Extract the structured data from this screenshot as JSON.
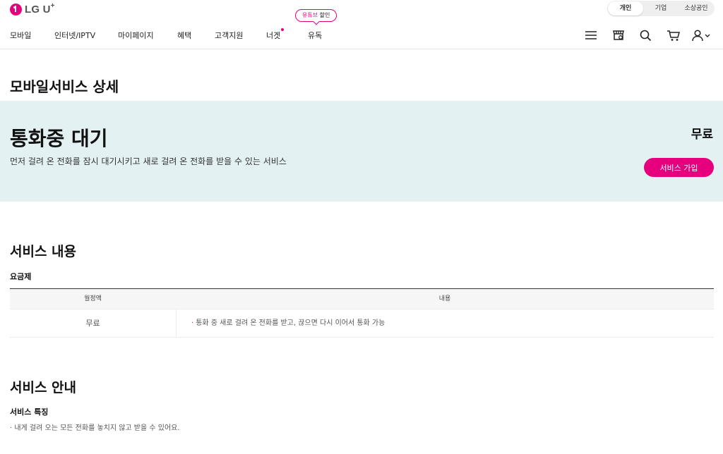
{
  "brand": {
    "logo_text": "LG U",
    "logo_plus": "+"
  },
  "segments": [
    "개인",
    "기업",
    "소상공인"
  ],
  "segment_active": "개인",
  "nav": {
    "items": [
      "모바일",
      "인터넷/IPTV",
      "마이페이지",
      "혜택",
      "고객지원",
      "너겟",
      "유독"
    ],
    "promo_prefix": "유튜브",
    "promo_suffix": "할인",
    "icons": [
      "menu-icon",
      "store-icon",
      "search-icon",
      "cart-icon",
      "user-icon"
    ]
  },
  "page_title": "모바일서비스 상세",
  "hero": {
    "title": "통화중 대기",
    "description": "먼저 걸려 온 전화를 잠시 대기시키고 새로 걸려 온 전화를 받을 수 있는 서비스",
    "price": "무료",
    "join_label": "서비스 가입"
  },
  "service_content": {
    "title": "서비스 내용",
    "subtitle": "요금제",
    "table": {
      "headers": [
        "월정액",
        "내용"
      ],
      "rows": [
        {
          "price": "무료",
          "content": "통화 중 새로 걸려 온 전화를 받고, 끊으면 다시 이어서 통화 가능"
        }
      ]
    }
  },
  "service_guide": {
    "title": "서비스 안내",
    "feature_title": "서비스 특징",
    "feature_text": "· 내게 걸려 오는 모든 전화를 놓치지 않고 받을 수 있어요."
  },
  "colors": {
    "brand": "#e6007e",
    "hero_bg": "#e3f1f2"
  }
}
